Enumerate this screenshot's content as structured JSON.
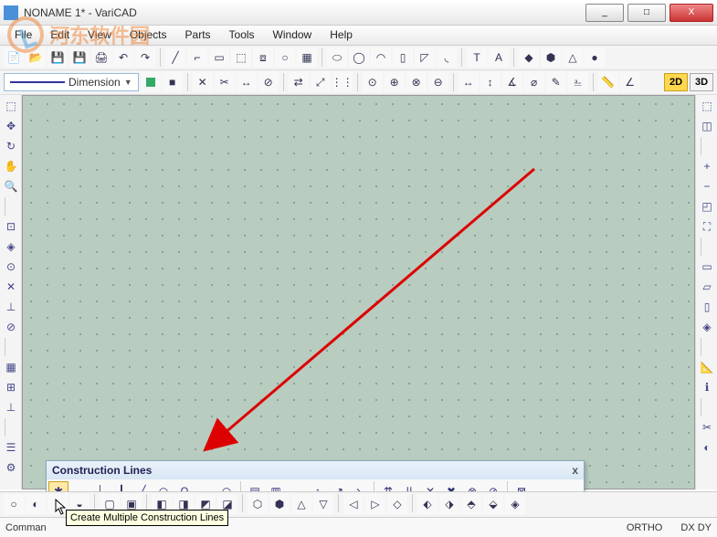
{
  "window": {
    "title": "NONAME 1* - VariCAD",
    "min": "_",
    "max": "□",
    "close": "X"
  },
  "menu": [
    "File",
    "Edit",
    "View",
    "Objects",
    "Parts",
    "Tools",
    "Window",
    "Help"
  ],
  "linestyle": {
    "label": "Dimension"
  },
  "viewbuttons": {
    "d2": "2D",
    "d3": "3D"
  },
  "float": {
    "title": "Construction Lines",
    "close": "x"
  },
  "tooltip": "Create Multiple Construction Lines",
  "cmd": {
    "label": "Comman"
  },
  "status": {
    "ortho": "ORTHO",
    "dxdy": "DX DY"
  },
  "watermark": "河东软件园",
  "icons": {
    "tb1": [
      "new",
      "open",
      "save",
      "saveall",
      "print",
      "undo",
      "redo",
      "",
      "line",
      "polyline",
      "rect",
      "box",
      "offset",
      "circ",
      "hatch",
      "",
      "ellipse",
      "isocirc",
      "arc",
      "rectangle",
      "chamfer",
      "fillet",
      "",
      "text",
      "text2",
      "",
      "solid",
      "cyl",
      "cone",
      "sphere"
    ],
    "tb2": [
      "sq",
      "",
      "delete",
      "trim",
      "extend",
      "break",
      "",
      "mirror",
      "scale",
      "array",
      "",
      "snap1",
      "snap2",
      "snap3",
      "snap4",
      "",
      "dim1",
      "dim2",
      "dim3",
      "dim4",
      "note",
      "label",
      "",
      "ruler",
      "angle"
    ],
    "left": [
      "sel",
      "move",
      "rot",
      "pan",
      "zoom",
      "",
      "endp",
      "mid",
      "cen",
      "int",
      "perp",
      "tan",
      "",
      "grid",
      "snap",
      "ortho",
      "",
      "layer",
      "prop"
    ],
    "right": [
      "view1",
      "view2",
      "",
      "zin",
      "zout",
      "zwin",
      "zall",
      "",
      "front",
      "top",
      "side",
      "iso",
      "",
      "measu",
      "info",
      "",
      "cut",
      "clip"
    ],
    "fb": [
      "multi",
      "hline",
      "vline",
      "vl2",
      "dline",
      "arc",
      "half",
      "lpar",
      "rpar",
      "",
      "hatch1",
      "hatch2",
      "dim1",
      "dim2",
      "off1",
      "off2",
      "",
      "par1",
      "par2",
      "del1",
      "del2",
      "delx1",
      "delx2",
      "",
      "clo"
    ],
    "sb": [
      "s1",
      "s2",
      "s3",
      "s4",
      "",
      "s5",
      "s6",
      "",
      "s7",
      "s8",
      "s9",
      "s10",
      "",
      "s11",
      "s12",
      "s13",
      "s14",
      "",
      "s15",
      "s16",
      "s17",
      "",
      "s18",
      "s19",
      "s20",
      "s21",
      "s22"
    ]
  }
}
